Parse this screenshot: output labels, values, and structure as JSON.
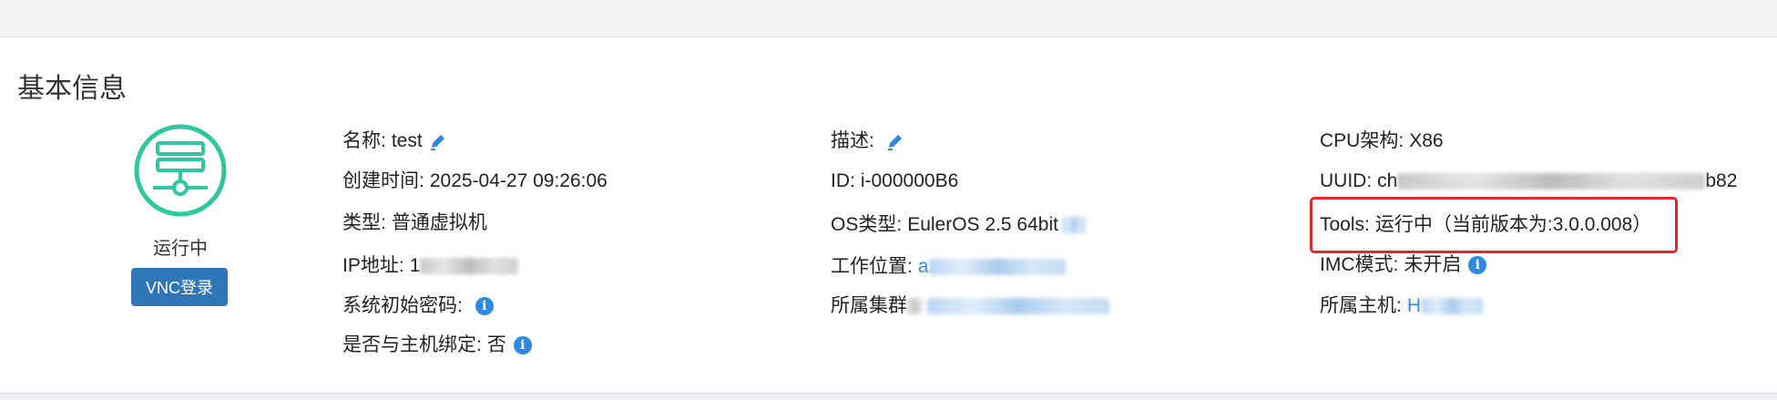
{
  "section_title": "基本信息",
  "vm": {
    "status": "运行中",
    "vnc_button": "VNC登录"
  },
  "col1": {
    "name_label": "名称:",
    "name_value": "test",
    "created_label": "创建时间:",
    "created_value": "2025-04-27 09:26:06",
    "type_label": "类型:",
    "type_value": "普通虚拟机",
    "ip_label": "IP地址:",
    "ip_value": "1",
    "init_pwd_label": "系统初始密码:",
    "bind_label": "是否与主机绑定:",
    "bind_value": "否"
  },
  "col2": {
    "desc_label": "描述:",
    "id_label": "ID:",
    "id_value": "i-000000B6",
    "os_label": "OS类型:",
    "os_value": "EulerOS 2.5 64bit",
    "location_label": "工作位置:",
    "location_value": "a",
    "cluster_label": "所属集群"
  },
  "col3": {
    "cpu_label": "CPU架构:",
    "cpu_value": "X86",
    "uuid_label": "UUID:",
    "uuid_prefix": "ch",
    "uuid_suffix": "b82",
    "tools_label": "Tools:",
    "tools_value": "运行中（当前版本为:3.0.0.008）",
    "imc_label": "IMC模式:",
    "imc_value": "未开启",
    "host_label": "所属主机:",
    "host_value": "H"
  },
  "colors": {
    "accent": "#2d8ae0",
    "button": "#2f77b7",
    "vm_icon": "#2ec7a0",
    "highlight": "#e3262c"
  }
}
